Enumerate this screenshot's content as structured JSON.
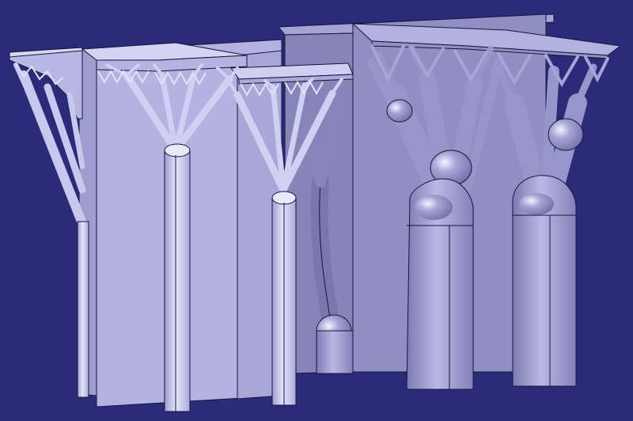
{
  "viewport": {
    "background": "#2b2b7a",
    "part_colors": {
      "left_group_face": "#c9c9ee",
      "left_group_side": "#a6a6d8",
      "right_group_face": "#9a9acb",
      "right_group_side": "#7d7db2",
      "edge_line": "#15153a"
    }
  },
  "objects": [
    {
      "label": "support-structure-thin-branches",
      "style": "slender tree supports",
      "columns": 3
    },
    {
      "label": "support-structure-thick-branches",
      "style": "organic tree supports",
      "columns": 3
    }
  ]
}
